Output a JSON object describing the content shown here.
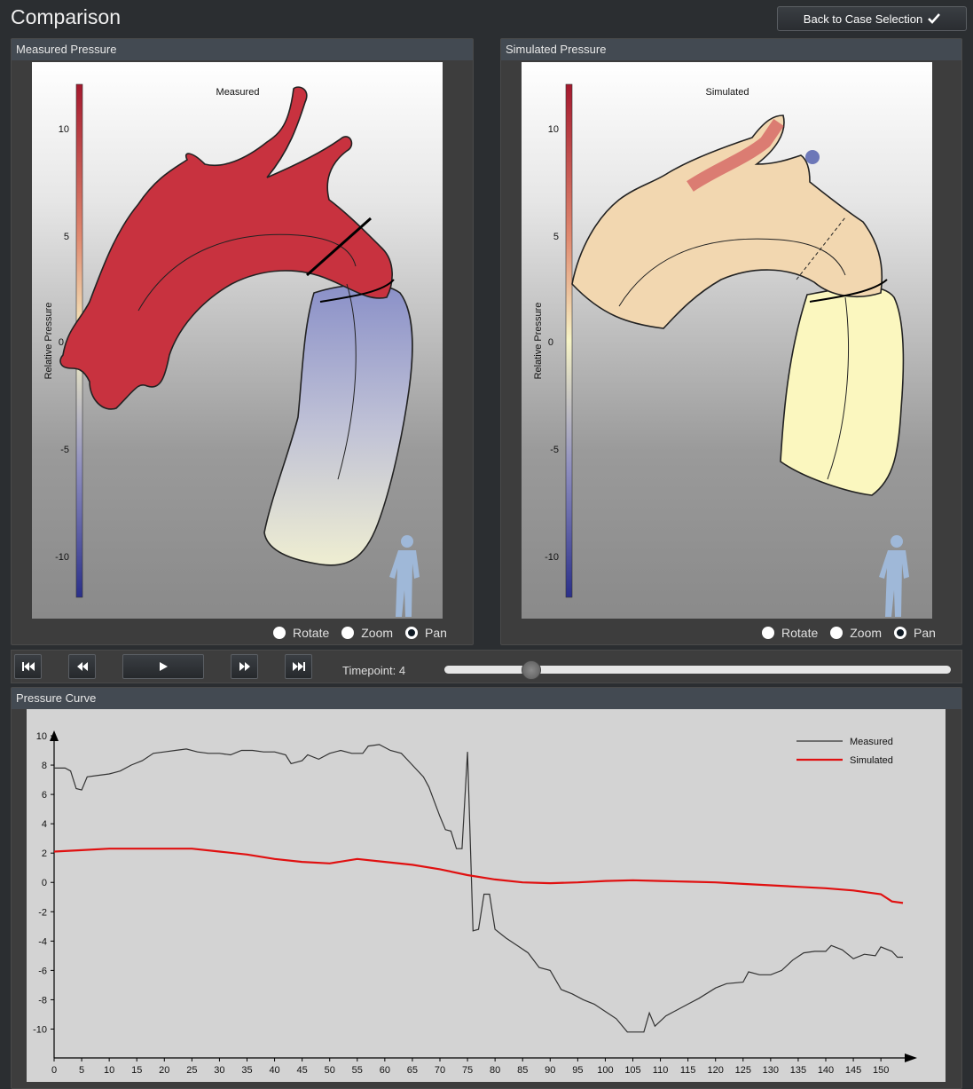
{
  "page": {
    "title": "Comparison"
  },
  "header": {
    "back_button_label": "Back to Case Selection",
    "back_button_icon": "checkmark-icon"
  },
  "panels": {
    "measured": {
      "header": "Measured Pressure",
      "plot_title": "Measured",
      "colorbar_label": "Relative Pressure",
      "colorbar_ticks": [
        "10",
        "5",
        "0",
        "-5",
        "-10"
      ],
      "body_icon": "human-figure-icon"
    },
    "simulated": {
      "header": "Simulated Pressure",
      "plot_title": "Simulated",
      "colorbar_label": "Relative Pressure",
      "colorbar_ticks": [
        "10",
        "5",
        "0",
        "-5",
        "-10"
      ],
      "body_icon": "human-figure-icon"
    }
  },
  "view_modes": {
    "options": [
      "Rotate",
      "Zoom",
      "Pan"
    ],
    "selected": "Pan",
    "rotate": "Rotate",
    "zoom": "Zoom",
    "pan": "Pan"
  },
  "playback": {
    "first_icon": "skip-to-start-icon",
    "rewind_icon": "rewind-icon",
    "play_icon": "play-icon",
    "forward_icon": "fast-forward-icon",
    "last_icon": "skip-to-end-icon",
    "timepoint_label": "Timepoint: 4",
    "timepoint": 4,
    "slider_fraction": 0.17
  },
  "pressure_curve": {
    "header": "Pressure Curve"
  },
  "chart_data": {
    "type": "line",
    "title": "",
    "xlabel": "",
    "ylabel": "",
    "xlim": [
      0,
      154
    ],
    "ylim": [
      -11,
      10
    ],
    "x_ticks": [
      0,
      5,
      10,
      15,
      20,
      25,
      30,
      35,
      40,
      45,
      50,
      55,
      60,
      65,
      70,
      75,
      80,
      85,
      90,
      95,
      100,
      105,
      110,
      115,
      120,
      125,
      130,
      135,
      140,
      145,
      150
    ],
    "y_ticks": [
      10,
      8,
      6,
      4,
      2,
      0,
      -2,
      -4,
      -6,
      -8,
      -10
    ],
    "legend_position": "top-right",
    "series": [
      {
        "name": "Measured",
        "color": "#333333",
        "points": [
          [
            0,
            7.8
          ],
          [
            2,
            7.8
          ],
          [
            3,
            7.6
          ],
          [
            4,
            6.4
          ],
          [
            5,
            6.3
          ],
          [
            6,
            7.2
          ],
          [
            8,
            7.3
          ],
          [
            10,
            7.4
          ],
          [
            12,
            7.6
          ],
          [
            14,
            8.0
          ],
          [
            16,
            8.3
          ],
          [
            18,
            8.8
          ],
          [
            20,
            8.9
          ],
          [
            22,
            9.0
          ],
          [
            24,
            9.1
          ],
          [
            26,
            8.9
          ],
          [
            28,
            8.8
          ],
          [
            30,
            8.8
          ],
          [
            32,
            8.7
          ],
          [
            34,
            9.0
          ],
          [
            36,
            9.0
          ],
          [
            38,
            8.9
          ],
          [
            40,
            8.9
          ],
          [
            42,
            8.7
          ],
          [
            43,
            8.1
          ],
          [
            45,
            8.3
          ],
          [
            46,
            8.7
          ],
          [
            48,
            8.4
          ],
          [
            50,
            8.8
          ],
          [
            52,
            9.0
          ],
          [
            54,
            8.8
          ],
          [
            56,
            8.8
          ],
          [
            57,
            9.3
          ],
          [
            59,
            9.4
          ],
          [
            61,
            9.0
          ],
          [
            63,
            8.8
          ],
          [
            64,
            8.4
          ],
          [
            65,
            8.0
          ],
          [
            67,
            7.2
          ],
          [
            68,
            6.5
          ],
          [
            69,
            5.5
          ],
          [
            70,
            4.5
          ],
          [
            71,
            3.6
          ],
          [
            72,
            3.5
          ],
          [
            73,
            2.3
          ],
          [
            74,
            2.3
          ],
          [
            75,
            8.9
          ],
          [
            76,
            -3.3
          ],
          [
            77,
            -3.2
          ],
          [
            78,
            -0.8
          ],
          [
            79,
            -0.8
          ],
          [
            80,
            -3.2
          ],
          [
            82,
            -3.8
          ],
          [
            84,
            -4.3
          ],
          [
            86,
            -4.8
          ],
          [
            88,
            -5.8
          ],
          [
            90,
            -6.0
          ],
          [
            92,
            -7.3
          ],
          [
            94,
            -7.6
          ],
          [
            96,
            -8.0
          ],
          [
            98,
            -8.3
          ],
          [
            100,
            -8.8
          ],
          [
            102,
            -9.3
          ],
          [
            104,
            -10.2
          ],
          [
            107,
            -10.2
          ],
          [
            108,
            -8.9
          ],
          [
            109,
            -9.8
          ],
          [
            111,
            -9.1
          ],
          [
            113,
            -8.7
          ],
          [
            115,
            -8.3
          ],
          [
            117,
            -7.9
          ],
          [
            120,
            -7.2
          ],
          [
            122,
            -6.9
          ],
          [
            125,
            -6.8
          ],
          [
            126,
            -6.1
          ],
          [
            128,
            -6.3
          ],
          [
            130,
            -6.3
          ],
          [
            132,
            -6.0
          ],
          [
            134,
            -5.3
          ],
          [
            136,
            -4.8
          ],
          [
            138,
            -4.7
          ],
          [
            140,
            -4.7
          ],
          [
            141,
            -4.3
          ],
          [
            143,
            -4.6
          ],
          [
            145,
            -5.2
          ],
          [
            147,
            -4.9
          ],
          [
            149,
            -5.0
          ],
          [
            150,
            -4.4
          ],
          [
            152,
            -4.7
          ],
          [
            153,
            -5.1
          ],
          [
            154,
            -5.1
          ]
        ]
      },
      {
        "name": "Simulated",
        "color": "#e01010",
        "points": [
          [
            0,
            2.1
          ],
          [
            5,
            2.2
          ],
          [
            10,
            2.3
          ],
          [
            15,
            2.3
          ],
          [
            20,
            2.3
          ],
          [
            25,
            2.3
          ],
          [
            30,
            2.1
          ],
          [
            35,
            1.9
          ],
          [
            40,
            1.6
          ],
          [
            45,
            1.4
          ],
          [
            50,
            1.3
          ],
          [
            55,
            1.6
          ],
          [
            60,
            1.4
          ],
          [
            65,
            1.2
          ],
          [
            70,
            0.9
          ],
          [
            75,
            0.5
          ],
          [
            80,
            0.2
          ],
          [
            85,
            0.0
          ],
          [
            90,
            -0.05
          ],
          [
            95,
            0.0
          ],
          [
            100,
            0.1
          ],
          [
            105,
            0.15
          ],
          [
            110,
            0.1
          ],
          [
            115,
            0.05
          ],
          [
            120,
            0.0
          ],
          [
            125,
            -0.1
          ],
          [
            130,
            -0.2
          ],
          [
            135,
            -0.3
          ],
          [
            140,
            -0.4
          ],
          [
            145,
            -0.55
          ],
          [
            150,
            -0.8
          ],
          [
            152,
            -1.3
          ],
          [
            154,
            -1.4
          ]
        ]
      }
    ]
  }
}
